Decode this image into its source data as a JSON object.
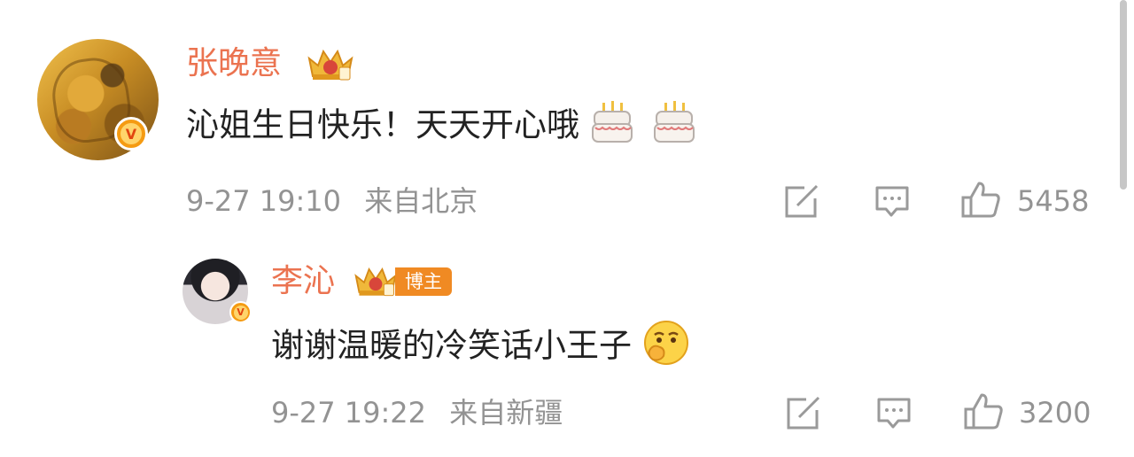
{
  "comment": {
    "author": "张晚意",
    "text": "沁姐生日快乐！天天开心哦",
    "emojis": [
      "cake-emoji",
      "cake-emoji"
    ],
    "date": "9-27 19:10",
    "location": "来自北京",
    "likes": "5458",
    "badge_icon": "crown-vip-icon",
    "verified_icon": "v-verified-icon"
  },
  "reply": {
    "author": "李沁",
    "role_badge": "博主",
    "text": "谢谢温暖的冷笑话小王子",
    "emoji": "thinking-emoji",
    "date": "9-27 19:22",
    "location": "来自新疆",
    "likes": "3200",
    "badge_icon": "crown-vip-icon",
    "verified_icon": "v-verified-icon"
  },
  "colors": {
    "name": "#eb7350",
    "text": "#222222",
    "meta": "#939393",
    "verified": "#f59b12",
    "host_badge": "#f08a23"
  }
}
